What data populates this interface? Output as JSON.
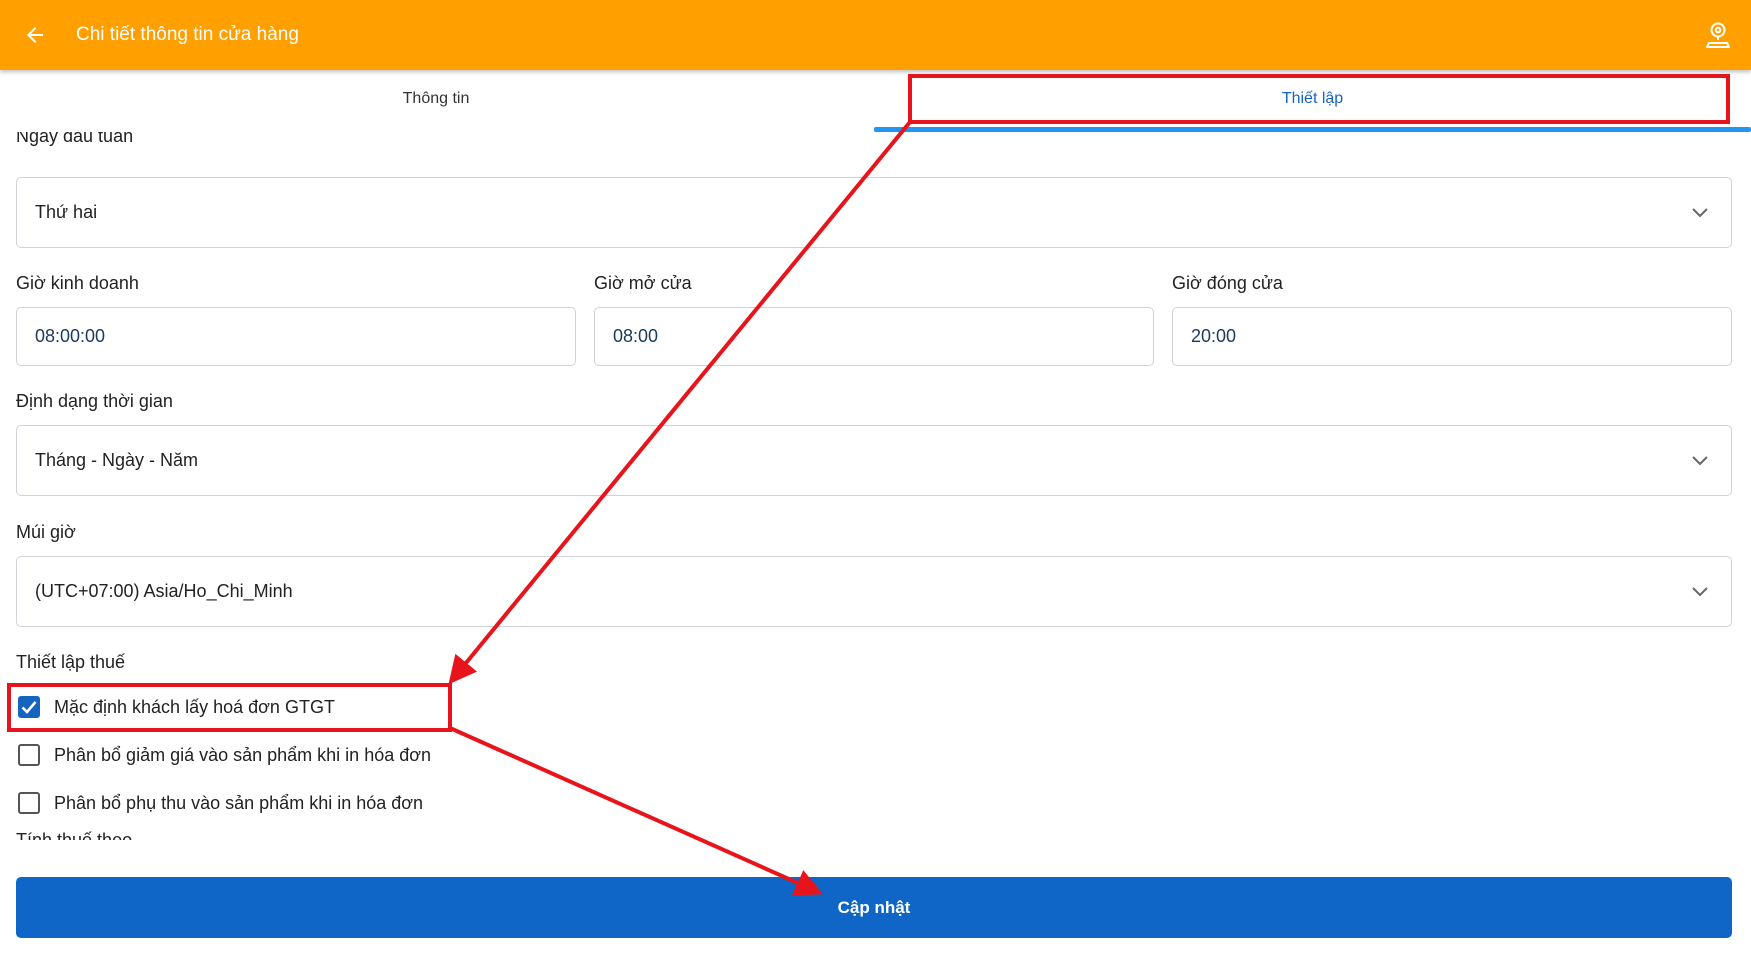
{
  "header": {
    "title": "Chi tiết thông tin cửa hàng",
    "back_icon": "arrow-left-icon",
    "location_icon": "location-pin-icon",
    "background_color": "#FFA000"
  },
  "tabs": [
    {
      "label": "Thông tin",
      "active": false
    },
    {
      "label": "Thiết lập",
      "active": true
    }
  ],
  "form": {
    "week_start": {
      "label": "Ngày đầu tuần",
      "value": "Thứ hai"
    },
    "business_hours": {
      "label": "Giờ kinh doanh",
      "value": "08:00:00"
    },
    "open_time": {
      "label": "Giờ mở cửa",
      "value": "08:00"
    },
    "close_time": {
      "label": "Giờ đóng cửa",
      "value": "20:00"
    },
    "time_format": {
      "label": "Định dạng thời gian",
      "value": "Tháng - Ngày - Năm"
    },
    "timezone": {
      "label": "Múi giờ",
      "value": "(UTC+07:00) Asia/Ho_Chi_Minh"
    },
    "tax_settings": {
      "label": "Thiết lập thuế",
      "options": [
        {
          "label": "Mặc định khách lấy hoá đơn GTGT",
          "checked": true
        },
        {
          "label": "Phân bổ giảm giá vào sản phẩm khi in hóa đơn",
          "checked": false
        },
        {
          "label": "Phân bổ phụ thu vào sản phẩm khi in hóa đơn",
          "checked": false
        }
      ]
    },
    "tax_calc": {
      "label": "Tính thuế theo"
    }
  },
  "actions": {
    "update_label": "Cập nhật",
    "update_color": "#0F66C6"
  },
  "annotation": {
    "color": "#E8141B"
  }
}
